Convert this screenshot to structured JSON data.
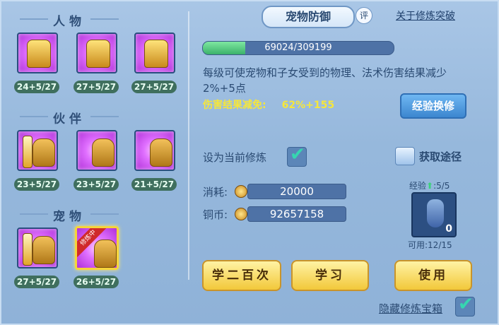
{
  "left": {
    "sections": [
      "人物",
      "伙伴",
      "宠物"
    ],
    "character": [
      {
        "level": "24+5/27"
      },
      {
        "level": "27+5/27"
      },
      {
        "level": "27+5/27"
      }
    ],
    "partner": [
      {
        "level": "23+5/27"
      },
      {
        "level": "23+5/27"
      },
      {
        "level": "21+5/27"
      }
    ],
    "pet": [
      {
        "level": "27+5/27"
      },
      {
        "level": "26+5/27",
        "badge": "修炼中"
      }
    ]
  },
  "header": {
    "title": "宠物防御",
    "eval": "评",
    "link": "关于修炼突破"
  },
  "progress": {
    "text": "69024/309199",
    "current": 69024,
    "max": 309199
  },
  "desc": "每级可使宠物和子女受到的物理、法术伤害结果减少2%+5点",
  "damage": {
    "label": "伤害结果减免:",
    "value": "62%+155"
  },
  "buttons": {
    "exchange": "经验换修",
    "study100": "学二百次",
    "study": "学习",
    "use": "使用"
  },
  "set_current": {
    "label": "设为当前修炼",
    "checked": true
  },
  "source": {
    "label": "获取途径"
  },
  "cost": {
    "label": "消耗:",
    "value": "20000"
  },
  "coins": {
    "label": "铜币:",
    "value": "92657158"
  },
  "item": {
    "exp_label": "经验",
    "exp_value": ":5/5",
    "count": "0",
    "usable": "可用:12/15"
  },
  "hide_chest": {
    "label": "隐藏修炼宝箱",
    "checked": true
  },
  "colors": {
    "accent": "#f2c83a",
    "bar": "#3bb16a",
    "text": "#2a4a72"
  }
}
